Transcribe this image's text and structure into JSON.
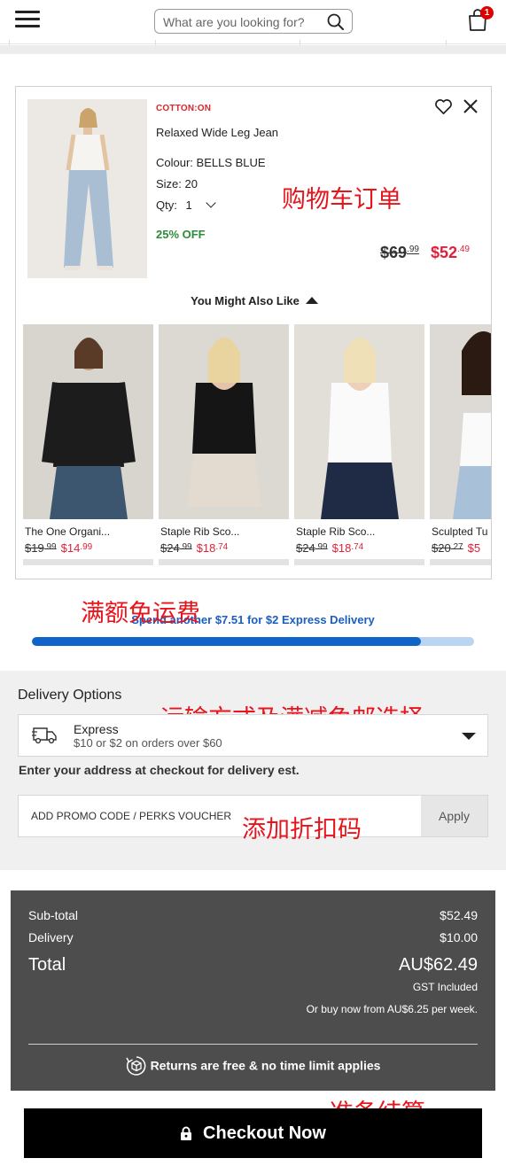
{
  "header": {
    "search_placeholder": "What are you looking for?",
    "cart_count": "1"
  },
  "cart_item": {
    "brand": "COTTON:ON",
    "name": "Relaxed Wide Leg Jean",
    "colour": "Colour: BELLS BLUE",
    "size": "Size: 20",
    "qty_label": "Qty:",
    "qty_value": "1",
    "discount": "25% OFF",
    "price_old_main": "$69",
    "price_old_cents": ".99",
    "price_new_main": "$52",
    "price_new_cents": ".49"
  },
  "recommendations": {
    "title": "You Might Also Like",
    "items": [
      {
        "name": "The One Organi...",
        "old_main": "$19",
        "old_cents": ".99",
        "new_main": "$14",
        "new_cents": ".99"
      },
      {
        "name": "Staple Rib Sco...",
        "old_main": "$24",
        "old_cents": ".99",
        "new_main": "$18",
        "new_cents": ".74"
      },
      {
        "name": "Staple Rib Sco...",
        "old_main": "$24",
        "old_cents": ".99",
        "new_main": "$18",
        "new_cents": ".74"
      },
      {
        "name": "Sculpted Tu",
        "old_main": "$20",
        "old_cents": ".27",
        "new_main": "$5",
        "new_cents": ""
      }
    ]
  },
  "annotations": {
    "cart_order": "购物车订单",
    "free_shipping": "满额免运费",
    "shipping_choice": "运输方式及满减免邮选择",
    "promo": "添加折扣码",
    "checkout": "准备结算"
  },
  "shipping": {
    "message": "Spend another $7.51 for $2 Express Delivery",
    "progress": 0.88
  },
  "delivery": {
    "title": "Delivery Options",
    "option_name": "Express",
    "option_desc": "$10 or $2 on orders over $60",
    "address_note": "Enter your address at checkout for delivery est."
  },
  "promo": {
    "placeholder": "ADD PROMO CODE / PERKS VOUCHER",
    "apply_label": "Apply"
  },
  "summary": {
    "subtotal_label": "Sub-total",
    "subtotal_value": "$52.49",
    "delivery_label": "Delivery",
    "delivery_value": "$10.00",
    "total_label": "Total",
    "total_value": "AU$62.49",
    "gst_note": "GST Included",
    "bnpl_note": "Or buy now from AU$6.25 per week.",
    "returns_note": "Returns are free & no time limit applies"
  },
  "checkout": {
    "label": "Checkout Now"
  },
  "colors": {
    "sale_red": "#e0203a",
    "brand_red": "#d8262e",
    "discount_green": "#2e8b3a",
    "progress_blue": "#0f63c9",
    "summary_bg": "#4d4d4d"
  }
}
